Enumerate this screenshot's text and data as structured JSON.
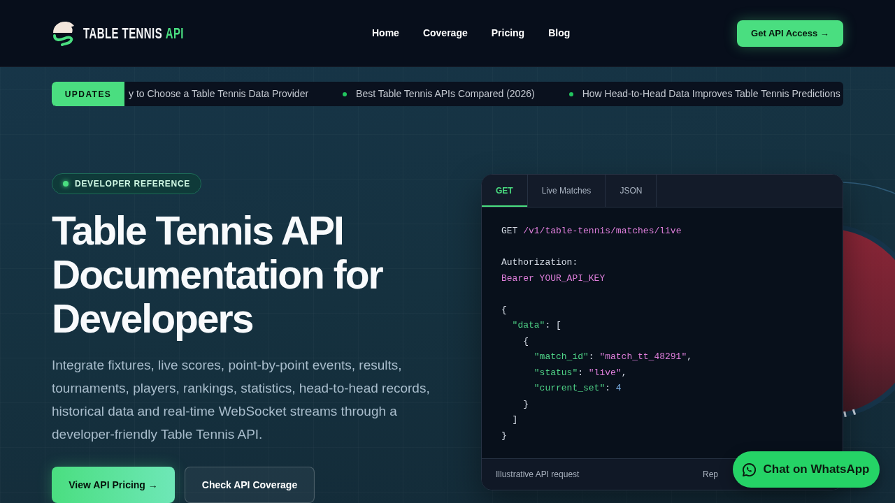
{
  "header": {
    "logo": {
      "text": "TABLE TENNIS",
      "accent": "API"
    },
    "nav": [
      "Home",
      "Coverage",
      "Pricing",
      "Blog"
    ],
    "cta": "Get API Access →"
  },
  "ticker": {
    "badge": "UPDATES",
    "items": [
      "y to Choose a Table Tennis Data Provider",
      "Best Table Tennis APIs Compared (2026)",
      "How Head-to-Head Data Improves Table Tennis Predictions"
    ]
  },
  "hero": {
    "eyebrow": "DEVELOPER REFERENCE",
    "title": "Table Tennis API Documentation for Developers",
    "description": "Integrate fixtures, live scores, point-by-point events, results, tournaments, players, rankings, statistics, head-to-head records, historical data and real-time WebSocket streams through a developer-friendly Table Tennis API.",
    "buttons": [
      {
        "label": "View API Pricing →",
        "kind": "primary"
      },
      {
        "label": "Check API Coverage",
        "kind": "secondary"
      }
    ]
  },
  "code_panel": {
    "tabs": [
      {
        "label": "GET",
        "selected": true
      },
      {
        "label": "Live Matches",
        "selected": false
      },
      {
        "label": "JSON",
        "selected": false
      }
    ],
    "blocks": [
      [
        {
          "tokens": [
            {
              "kind": "plain",
              "text": "GET "
            },
            {
              "kind": "string",
              "text": "/v1/table-tennis/matches/live"
            }
          ]
        }
      ],
      [
        {
          "tokens": [
            {
              "kind": "plain",
              "text": "Authorization:"
            }
          ]
        },
        {
          "tokens": [
            {
              "kind": "string",
              "text": "Bearer YOUR_API_KEY"
            }
          ]
        }
      ],
      [
        {
          "tokens": [
            {
              "kind": "plain",
              "text": "{"
            }
          ],
          "children": [
            {
              "tokens": [
                {
                  "kind": "key",
                  "text": "\"data\""
                },
                {
                  "kind": "plain",
                  "text": ": ["
                }
              ],
              "children": [
                {
                  "tokens": [
                    {
                      "kind": "plain",
                      "text": "{"
                    }
                  ],
                  "children": [
                    {
                      "tokens": [
                        {
                          "kind": "key",
                          "text": "\"match_id\""
                        },
                        {
                          "kind": "plain",
                          "text": ": "
                        },
                        {
                          "kind": "string",
                          "text": "\"match_tt_48291\""
                        },
                        {
                          "kind": "plain",
                          "text": ","
                        }
                      ]
                    },
                    {
                      "tokens": [
                        {
                          "kind": "key",
                          "text": "\"status\""
                        },
                        {
                          "kind": "plain",
                          "text": ": "
                        },
                        {
                          "kind": "string",
                          "text": "\"live\""
                        },
                        {
                          "kind": "plain",
                          "text": ","
                        }
                      ]
                    },
                    {
                      "tokens": [
                        {
                          "kind": "key",
                          "text": "\"current_set\""
                        },
                        {
                          "kind": "plain",
                          "text": ": "
                        },
                        {
                          "kind": "number",
                          "text": "4"
                        }
                      ]
                    }
                  ]
                },
                {
                  "tokens": [
                    {
                      "kind": "plain",
                      "text": "}"
                    }
                  ]
                }
              ]
            },
            {
              "tokens": [
                {
                  "kind": "plain",
                  "text": "]"
                }
              ]
            }
          ]
        },
        {
          "tokens": [
            {
              "kind": "plain",
              "text": "}"
            }
          ]
        }
      ]
    ],
    "footer": {
      "note": "Illustrative API request",
      "right": "Rep"
    }
  },
  "chat_button": {
    "label": "Chat on WhatsApp"
  }
}
